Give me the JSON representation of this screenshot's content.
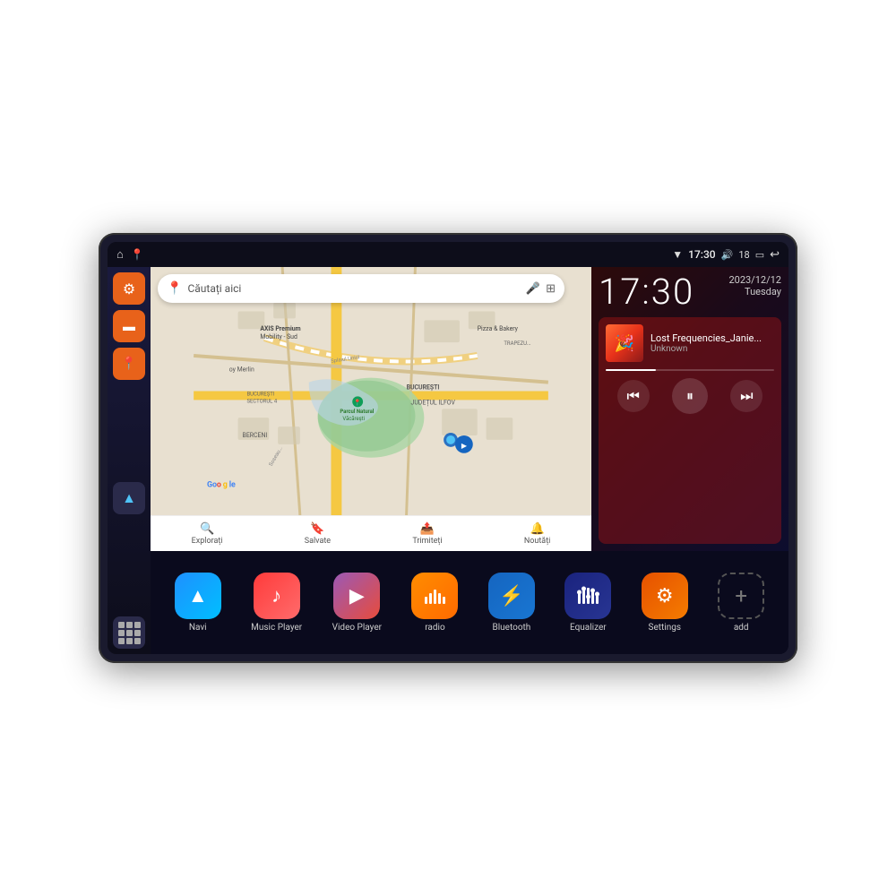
{
  "device": {
    "status_bar": {
      "left_icons": [
        "home-icon",
        "map-icon"
      ],
      "wifi_icon": "▼",
      "time": "17:30",
      "volume_icon": "🔊",
      "battery_level": "18",
      "battery_icon": "🔋",
      "back_icon": "↩"
    },
    "clock": {
      "time": "17:30",
      "date_line1": "2023/12/12",
      "date_line2": "Tuesday"
    },
    "music": {
      "title": "Lost Frequencies_Janie...",
      "artist": "Unknown",
      "prev_label": "⏮",
      "play_label": "⏸",
      "next_label": "⏭"
    },
    "map": {
      "search_placeholder": "Căutați aici",
      "toolbar": [
        {
          "icon": "📍",
          "label": "Explorați"
        },
        {
          "icon": "🔖",
          "label": "Salvate"
        },
        {
          "icon": "📤",
          "label": "Trimiteți"
        },
        {
          "icon": "🔔",
          "label": "Noutăți"
        }
      ],
      "places": [
        "AXIS Premium Mobility - Sud",
        "Parcul Natural Văcărești",
        "Pizza & Bakery",
        "BUCUREȘTI SECTORUL 4",
        "BUCUREȘTI",
        "JUDEȚUL ILFOV",
        "BERCENI",
        "oy Merlin"
      ]
    },
    "sidebar": {
      "buttons": [
        {
          "icon": "⚙",
          "color": "orange",
          "label": "settings"
        },
        {
          "icon": "📁",
          "color": "orange",
          "label": "files"
        },
        {
          "icon": "📍",
          "color": "orange",
          "label": "map"
        },
        {
          "icon": "▲",
          "color": "dark",
          "label": "nav"
        }
      ]
    },
    "apps": [
      {
        "name": "Navi",
        "icon": "▲",
        "color": "blue-grad"
      },
      {
        "name": "Music Player",
        "icon": "♪",
        "color": "red-grad"
      },
      {
        "name": "Video Player",
        "icon": "▶",
        "color": "purple-grad"
      },
      {
        "name": "radio",
        "icon": "📻",
        "color": "orange-grad"
      },
      {
        "name": "Bluetooth",
        "icon": "⚡",
        "color": "blue-bt"
      },
      {
        "name": "Equalizer",
        "icon": "🎚",
        "color": "dark-blue"
      },
      {
        "name": "Settings",
        "icon": "⚙",
        "color": "orange-set"
      },
      {
        "name": "add",
        "icon": "+",
        "color": "gray-add"
      }
    ]
  }
}
